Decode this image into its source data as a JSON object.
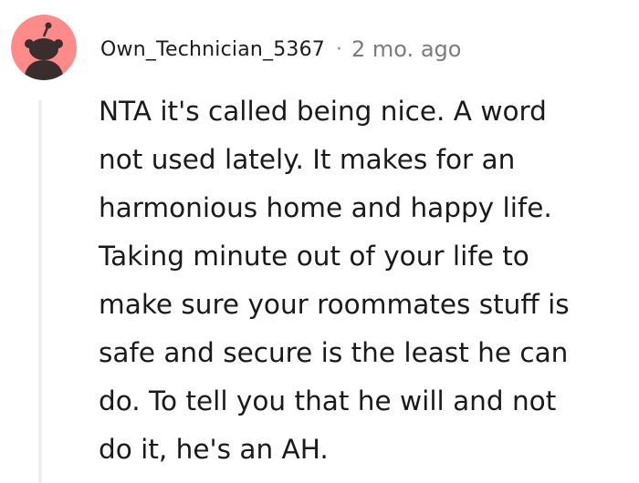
{
  "comment": {
    "author": "Own_Technician_5367",
    "separator": "·",
    "timestamp": "2 mo. ago",
    "avatar_icon": "reddit-snoo-avatar-icon",
    "body_lines": [
      "NTA it's called being nice. A word",
      "not used lately. It makes for an",
      "harmonious home and happy life.",
      "Taking minute out of your life to",
      "make sure your roommates stuff is",
      "safe and secure is the least he can",
      "do. To tell you that he will and not",
      "do it, he's an AH."
    ]
  },
  "colors": {
    "avatar_background": "#ff8a8a",
    "avatar_figure": "#3a2d2d",
    "thread_line": "#edeff1",
    "text": "#1a1a1b",
    "meta_gray": "#7c7c7c"
  }
}
